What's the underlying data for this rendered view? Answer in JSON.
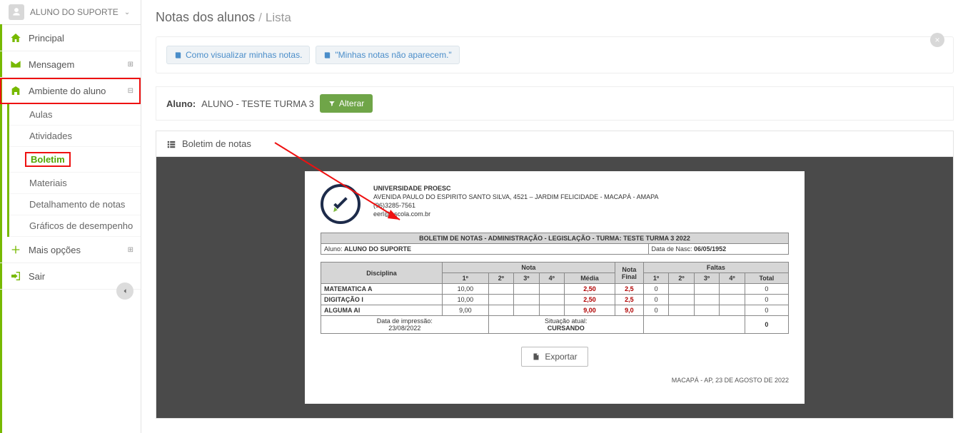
{
  "user": {
    "name": "ALUNO DO SUPORTE"
  },
  "sidebar": {
    "principal": "Principal",
    "mensagem": "Mensagem",
    "ambiente": "Ambiente do aluno",
    "subs": [
      "Aulas",
      "Atividades",
      "Boletim",
      "Materiais",
      "Detalhamento de notas",
      "Gráficos de desempenho"
    ],
    "mais": "Mais opções",
    "sair": "Sair"
  },
  "breadcrumb": {
    "main": "Notas dos alunos",
    "sep": "/",
    "sub": "Lista"
  },
  "help_pills": [
    "Como visualizar minhas notas.",
    "\"Minhas notas não aparecem.\""
  ],
  "student_row": {
    "label": "Aluno:",
    "name": "ALUNO - TESTE TURMA 3",
    "alterar": "Alterar"
  },
  "panel": {
    "title": "Boletim de notas"
  },
  "report": {
    "school": "UNIVERSIDADE PROESC",
    "address": "AVENIDA PAULO DO ESPIRITO SANTO SILVA, 4521 – JARDIM FELICIDADE - MACAPÁ - AMAPA",
    "phone": "(96)3285-7561",
    "email": "eerl@escola.com.br",
    "title": "BOLETIM DE NOTAS - ADMINISTRAÇÃO - LEGISLAÇÃO - TURMA: TESTE TURMA 3 2022",
    "aluno_label": "Aluno:",
    "aluno": "ALUNO DO SUPORTE",
    "nasc_label": "Data de Nasc:",
    "nasc": "06/05/1952",
    "headers": {
      "disc": "Disciplina",
      "nota": "Nota",
      "nota_final": "Nota Final",
      "faltas": "Faltas",
      "p1": "1º",
      "p2": "2º",
      "p3": "3º",
      "p4": "4º",
      "media": "Média",
      "total": "Total"
    },
    "rows": [
      {
        "disc": "MATEMATICA A",
        "n1": "10,00",
        "n2": "",
        "n3": "",
        "n4": "",
        "media": "2,50",
        "final": "2,5",
        "f1": "0",
        "f2": "",
        "f3": "",
        "f4": "",
        "ft": "0"
      },
      {
        "disc": "DIGITAÇÃO I",
        "n1": "10,00",
        "n2": "",
        "n3": "",
        "n4": "",
        "media": "2,50",
        "final": "2,5",
        "f1": "0",
        "f2": "",
        "f3": "",
        "f4": "",
        "ft": "0"
      },
      {
        "disc": "ALGUMA AI",
        "n1": "9,00",
        "n2": "",
        "n3": "",
        "n4": "",
        "media": "9,00",
        "final": "9,0",
        "f1": "0",
        "f2": "",
        "f3": "",
        "f4": "",
        "ft": "0"
      }
    ],
    "print_label": "Data de impressão:",
    "print_date": "23/08/2022",
    "status_label": "Situação atual:",
    "status": "CURSANDO",
    "total_faltas": "0",
    "export": "Exportar",
    "footer": "MACAPÁ - AP, 23 DE AGOSTO DE 2022"
  }
}
